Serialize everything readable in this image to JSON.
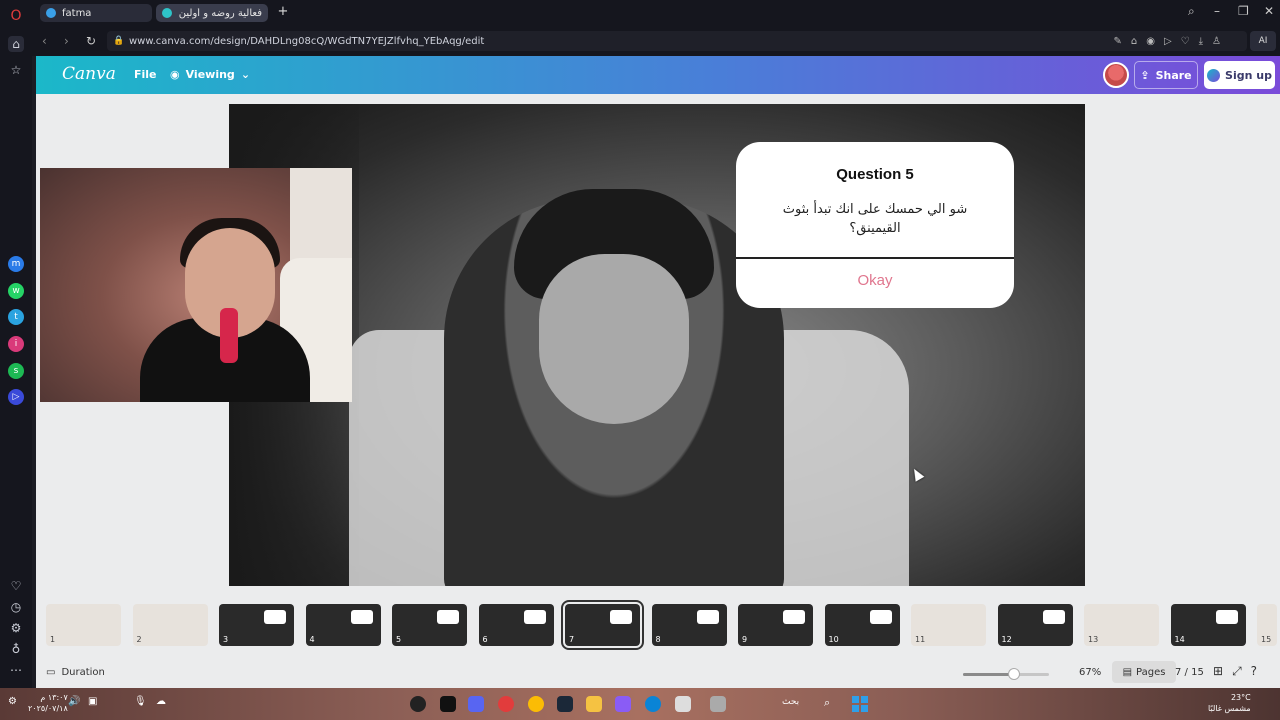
{
  "browser": {
    "tabs": [
      {
        "label": "fatma",
        "active": false
      },
      {
        "label": "فعالية روضه و أولين - ation",
        "active": true
      }
    ],
    "url": "www.canva.com/design/DAHDLng08cQ/WGdTN7YEJZlfvhq_YEbAqg/edit",
    "ai_label": "AI"
  },
  "canva": {
    "logo": "Canva",
    "menu_file": "File",
    "menu_viewing": "Viewing",
    "share_label": "Share",
    "signup_label": "Sign up"
  },
  "dialog": {
    "title": "Question 5",
    "text": "شو الي حمسك على انك تبدأ بثوث القيمينق؟",
    "button": "Okay"
  },
  "thumbnails": [
    {
      "num": "1",
      "light": true
    },
    {
      "num": "2",
      "light": true
    },
    {
      "num": "3",
      "light": false
    },
    {
      "num": "4",
      "light": false
    },
    {
      "num": "5",
      "light": false
    },
    {
      "num": "6",
      "light": false
    },
    {
      "num": "7",
      "light": false,
      "active": true
    },
    {
      "num": "8",
      "light": false
    },
    {
      "num": "9",
      "light": false
    },
    {
      "num": "10",
      "light": false
    },
    {
      "num": "11",
      "light": true
    },
    {
      "num": "12",
      "light": false
    },
    {
      "num": "13",
      "light": true
    },
    {
      "num": "14",
      "light": false
    },
    {
      "num": "15",
      "light": true
    }
  ],
  "footer": {
    "duration_label": "Duration",
    "zoom": "67%",
    "zoom_fraction": 0.58,
    "pages_label": "Pages",
    "page_indicator": "7 / 15"
  },
  "taskbar": {
    "time": "١٣:٠٧ م",
    "date": "٢٠٢٥/٠٧/١٨",
    "search": "بحث",
    "temperature": "23°C",
    "weather": "مشمس غالبًا"
  }
}
